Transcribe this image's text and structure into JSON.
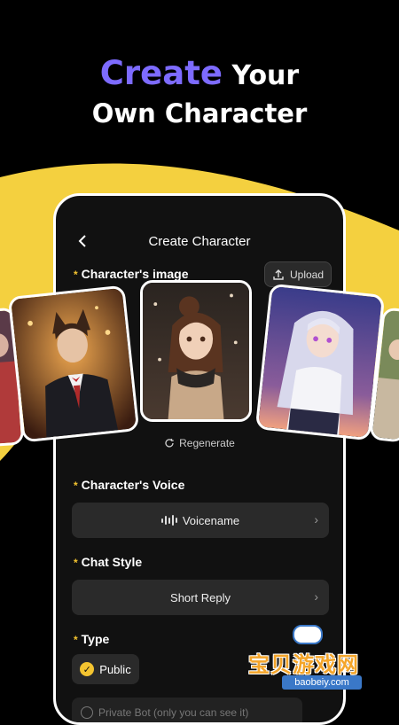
{
  "headline": {
    "accent": "Create",
    "line1_rest": " Your",
    "line2": "Own Character"
  },
  "screen": {
    "title": "Create Character",
    "image_label": "Character's image",
    "upload_label": "Upload",
    "regenerate_label": "Regenerate",
    "voice_label": "Character's Voice",
    "voice_value": "Voicename",
    "style_label": "Chat Style",
    "style_value": "Short Reply",
    "type_label": "Type",
    "type_public": "Public",
    "type_private": "Private Bot (only you can see it)"
  },
  "watermark": {
    "logo_text": "宝贝游戏网",
    "url": "baobeiy.com"
  },
  "colors": {
    "accent": "#7d6bff",
    "yellow": "#f4d03f",
    "required": "#f4c430"
  }
}
